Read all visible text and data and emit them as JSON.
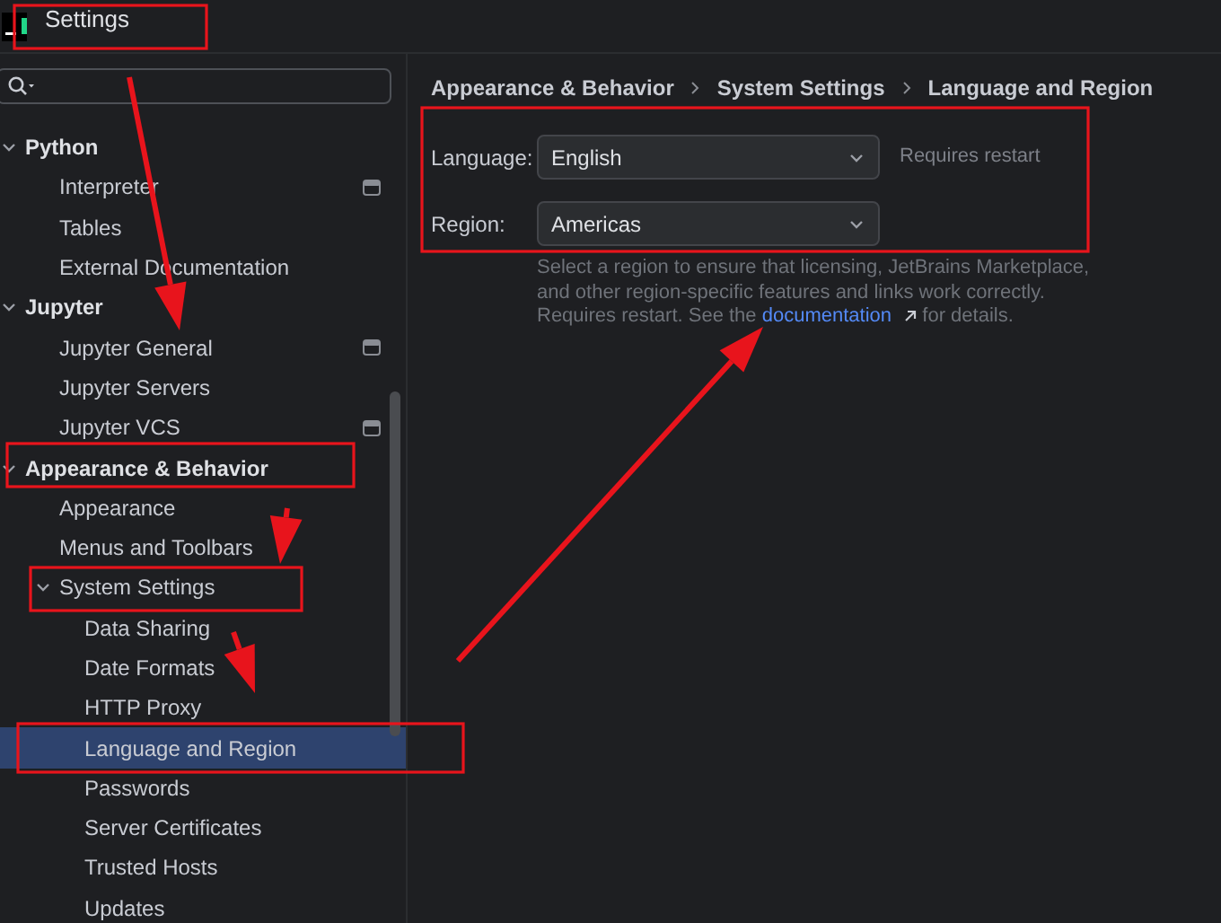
{
  "window": {
    "title": "Settings"
  },
  "tree": [
    {
      "label": "Python",
      "expanded": true,
      "selected": false,
      "children": [
        {
          "label": "Interpreter",
          "selected": false,
          "scoped": true
        },
        {
          "label": "Tables",
          "selected": false,
          "scoped": false
        },
        {
          "label": "External Documentation",
          "selected": false,
          "scoped": false
        }
      ]
    },
    {
      "label": "Jupyter",
      "expanded": true,
      "selected": false,
      "children": [
        {
          "label": "Jupyter General",
          "selected": false,
          "scoped": true
        },
        {
          "label": "Jupyter Servers",
          "selected": false,
          "scoped": false
        },
        {
          "label": "Jupyter VCS",
          "selected": false,
          "scoped": true
        }
      ]
    },
    {
      "label": "Appearance & Behavior",
      "expanded": true,
      "selected": false,
      "children": [
        {
          "label": "Appearance",
          "selected": false,
          "scoped": false
        },
        {
          "label": "Menus and Toolbars",
          "selected": false,
          "scoped": false
        },
        {
          "label": "System Settings",
          "expanded": true,
          "selected": false,
          "children": [
            {
              "label": "Data Sharing",
              "selected": false,
              "scoped": false
            },
            {
              "label": "Date Formats",
              "selected": false,
              "scoped": false
            },
            {
              "label": "HTTP Proxy",
              "selected": false,
              "scoped": false
            },
            {
              "label": "Language and Region",
              "selected": true,
              "scoped": false
            },
            {
              "label": "Passwords",
              "selected": false,
              "scoped": false
            },
            {
              "label": "Server Certificates",
              "selected": false,
              "scoped": false
            },
            {
              "label": "Trusted Hosts",
              "selected": false,
              "scoped": false
            },
            {
              "label": "Updates",
              "selected": false,
              "scoped": false
            }
          ]
        }
      ]
    }
  ],
  "breadcrumb": [
    "Appearance & Behavior",
    "System Settings",
    "Language and Region"
  ],
  "fields": [
    {
      "label": "Language:",
      "value": "English",
      "note": "Requires restart"
    },
    {
      "label": "Region:",
      "value": "Americas"
    }
  ],
  "help": {
    "before": "Select a region to ensure that licensing, JetBrains Marketplace, and other region-specific features and links work correctly. Requires restart. See the",
    "link": "documentation",
    "after": "for details."
  }
}
